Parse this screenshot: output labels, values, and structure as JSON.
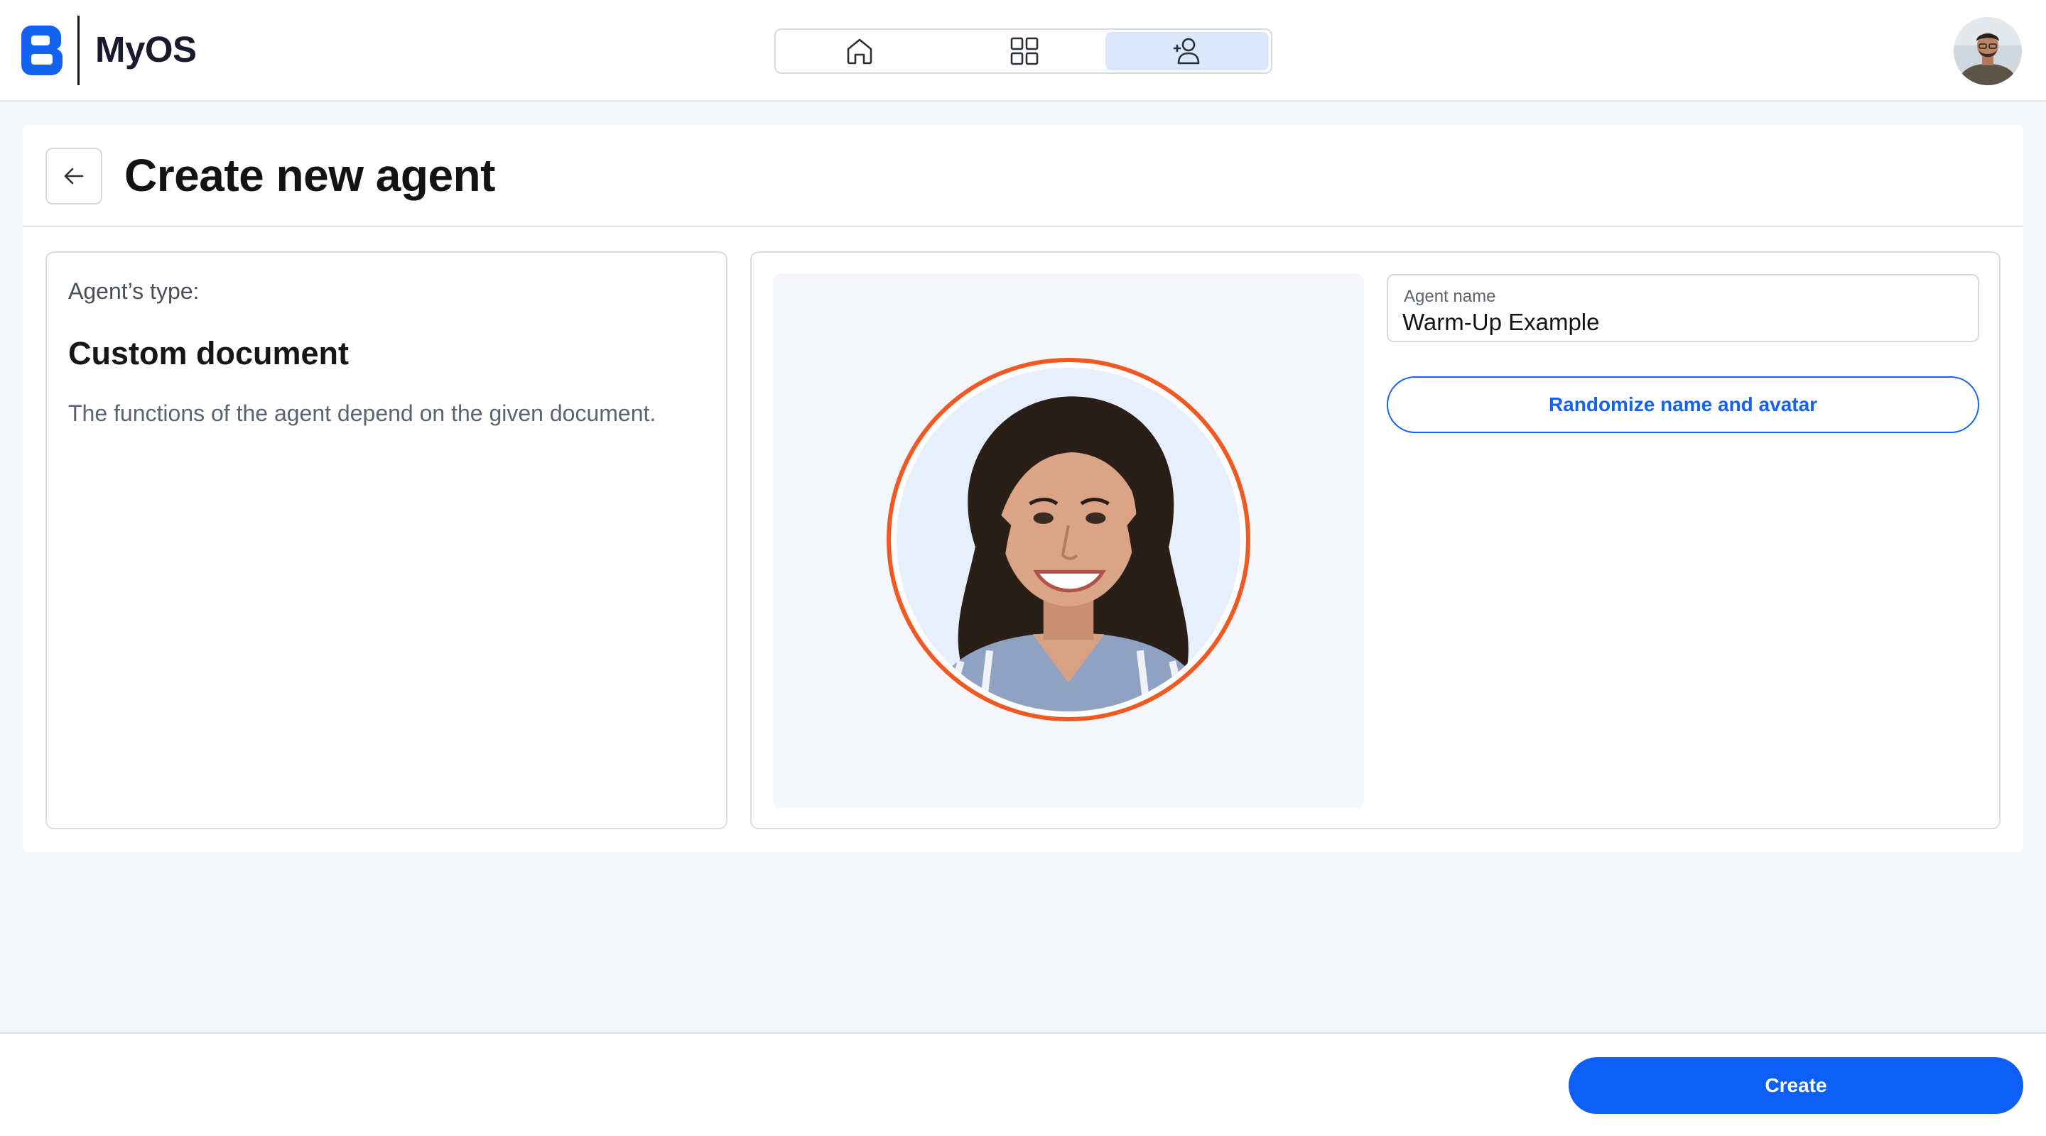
{
  "app": {
    "title": "MyOS",
    "logo_icon": "myos-logo-icon",
    "brand_color": "#1463f0"
  },
  "nav": {
    "items": [
      {
        "name": "home",
        "icon": "home-icon",
        "active": false
      },
      {
        "name": "apps",
        "icon": "grid-icon",
        "active": false
      },
      {
        "name": "agents",
        "icon": "add-user-icon",
        "active": true
      }
    ]
  },
  "user": {
    "avatar_icon": "user-avatar"
  },
  "page": {
    "title": "Create new agent",
    "back_icon": "arrow-left-icon"
  },
  "agent_type": {
    "label": "Agent’s type:",
    "name": "Custom document",
    "description": "The functions of the agent depend on the given document."
  },
  "agent": {
    "name_label": "Agent name",
    "name_value": "Warm-Up Example",
    "avatar_ring_color": "#f05a22",
    "randomize_label": "Randomize name and avatar"
  },
  "footer": {
    "create_label": "Create",
    "create_color": "#0d5ff5"
  }
}
